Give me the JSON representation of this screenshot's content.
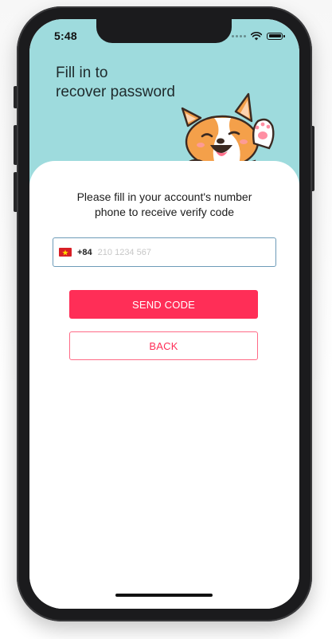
{
  "status_bar": {
    "time": "5:48",
    "signal_icon": "signal-dots-icon",
    "wifi_icon": "wifi-icon",
    "battery_icon": "battery-icon"
  },
  "header": {
    "title_line1": "Fill in to",
    "title_line2": "recover password",
    "illustration": "corgi-waving-illustration"
  },
  "form": {
    "prompt_line1": "Please fill in your account's number",
    "prompt_line2": "phone to receive verify code",
    "country_flag": "vietnam-flag-icon",
    "dial_code": "+84",
    "phone_value": "",
    "phone_placeholder": "210 1234 567"
  },
  "actions": {
    "send_label": "SEND CODE",
    "back_label": "BACK"
  },
  "colors": {
    "hero_background": "#9edbdd",
    "accent": "#ff2e57",
    "field_border": "#6d9bb8"
  }
}
